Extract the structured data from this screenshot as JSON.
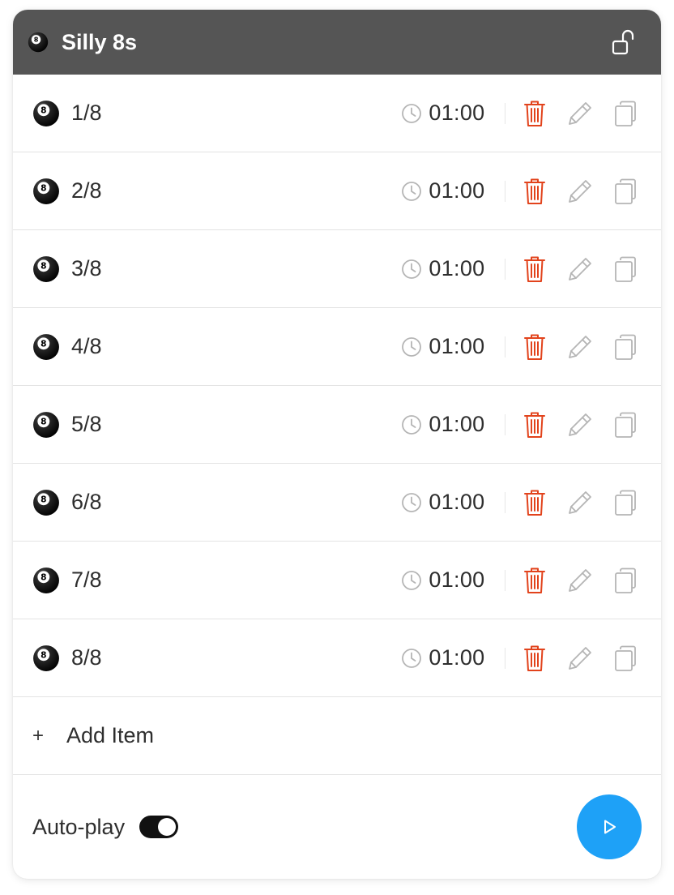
{
  "header": {
    "title": "Silly 8s",
    "icon": "8-ball-icon",
    "lock_icon": "unlocked-padlock-icon"
  },
  "items": [
    {
      "label": "1/8",
      "time": "01:00"
    },
    {
      "label": "2/8",
      "time": "01:00"
    },
    {
      "label": "3/8",
      "time": "01:00"
    },
    {
      "label": "4/8",
      "time": "01:00"
    },
    {
      "label": "5/8",
      "time": "01:00"
    },
    {
      "label": "6/8",
      "time": "01:00"
    },
    {
      "label": "7/8",
      "time": "01:00"
    },
    {
      "label": "8/8",
      "time": "01:00"
    }
  ],
  "add_item": {
    "icon": "+",
    "label": "Add Item"
  },
  "footer": {
    "autoplay_label": "Auto-play",
    "autoplay_on": true,
    "play_icon": "play-icon"
  },
  "colors": {
    "header_bg": "#555555",
    "delete": "#e2431c",
    "icon_gray": "#b5b5b5",
    "play_button": "#1ea1f7",
    "toggle_on": "#111111"
  }
}
